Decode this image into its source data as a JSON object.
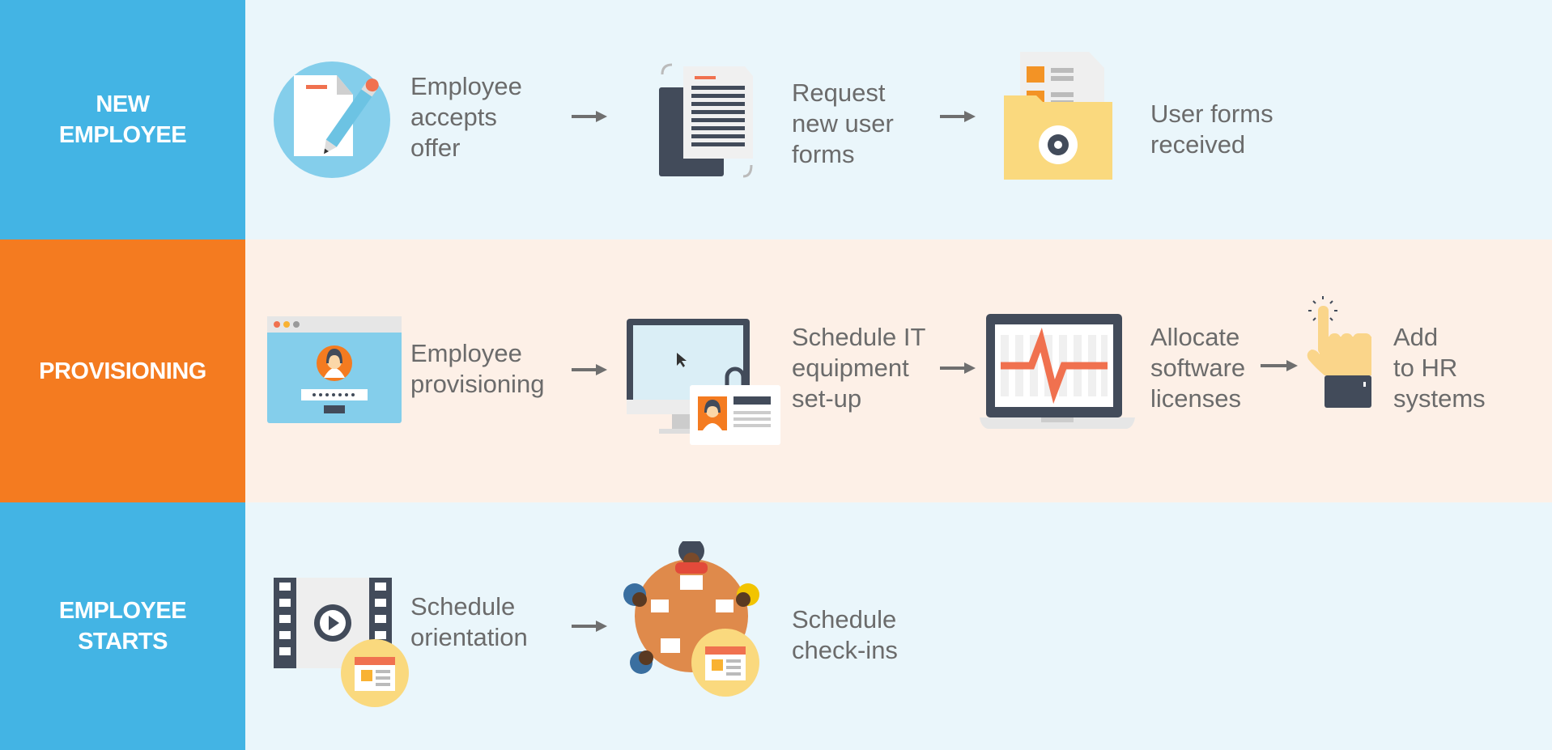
{
  "colors": {
    "new_employee": "#43b4e4",
    "provisioning": "#f47b20",
    "employee_starts": "#43b4e4",
    "row_blue_bg": "#eaf6fb",
    "row_peach_bg": "#fdf0e7",
    "text": "#6b6b6b",
    "arrow": "#6f6f6f"
  },
  "lanes": [
    {
      "label_lines": [
        "NEW",
        "EMPLOYEE"
      ],
      "steps": [
        {
          "icon": "document-pencil-icon",
          "lines": [
            "Employee",
            "accepts",
            "offer"
          ]
        },
        {
          "icon": "forms-document-icon",
          "lines": [
            "Request",
            "new user",
            "forms"
          ]
        },
        {
          "icon": "folder-gear-icon",
          "lines": [
            "User forms",
            "received"
          ]
        }
      ]
    },
    {
      "label_lines": [
        "PROVISIONING"
      ],
      "steps": [
        {
          "icon": "browser-login-icon",
          "lines": [
            "Employee",
            "provisioning"
          ]
        },
        {
          "icon": "monitor-id-badge-icon",
          "lines": [
            "Schedule IT",
            "equipment",
            "set-up"
          ]
        },
        {
          "icon": "laptop-chart-icon",
          "lines": [
            "Allocate",
            "software",
            "licenses"
          ]
        },
        {
          "icon": "pointing-hand-icon",
          "lines": [
            "Add",
            "to HR",
            "systems"
          ]
        }
      ]
    },
    {
      "label_lines": [
        "EMPLOYEE",
        "STARTS"
      ],
      "steps": [
        {
          "icon": "film-calendar-icon",
          "lines": [
            "Schedule",
            "orientation"
          ]
        },
        {
          "icon": "meeting-table-calendar-icon",
          "lines": [
            "Schedule",
            "check-ins"
          ]
        }
      ]
    }
  ]
}
